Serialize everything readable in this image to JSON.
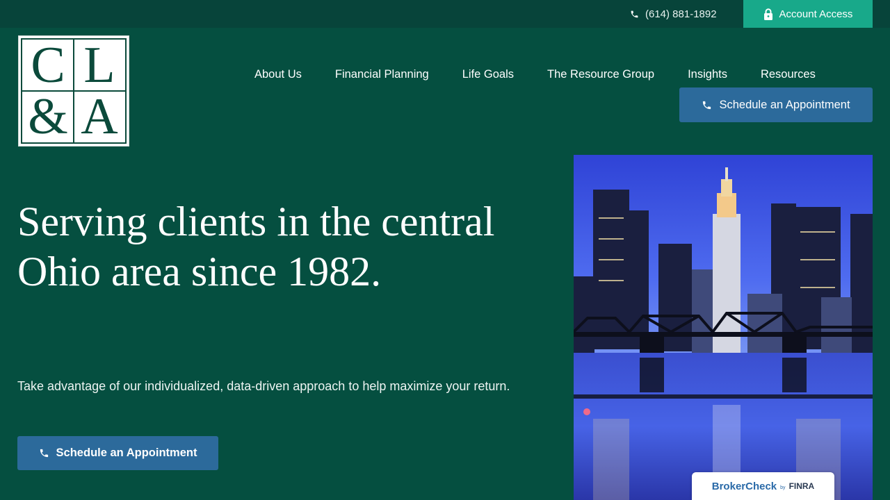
{
  "topbar": {
    "phone": "(614) 881-1892",
    "phone_icon": "phone-icon",
    "account_label": "Account Access",
    "account_icon": "lock-icon",
    "account_color": "#18a98a"
  },
  "logo": {
    "letters": [
      "C",
      "L",
      "&",
      "A"
    ],
    "color": "#0b4a3b"
  },
  "nav": {
    "items": [
      "About Us",
      "Financial Planning",
      "Life Goals",
      "The Resource Group",
      "Insights",
      "Resources"
    ]
  },
  "header_cta": {
    "label": "Schedule an Appointment",
    "icon": "phone-icon",
    "color": "#2c6a9b"
  },
  "hero": {
    "headline": "Serving clients in the central Ohio area since 1982.",
    "subtext": "Take advantage of our individualized, data-driven approach to help maximize your return.",
    "cta_label": "Schedule an Appointment",
    "cta_icon": "phone-icon",
    "image_icon": "city-skyline-image"
  },
  "brokercheck": {
    "main": "BrokerCheck",
    "by": "by",
    "finra": "FINRA"
  },
  "colors": {
    "background": "#054f40",
    "topbar": "#07443a"
  }
}
